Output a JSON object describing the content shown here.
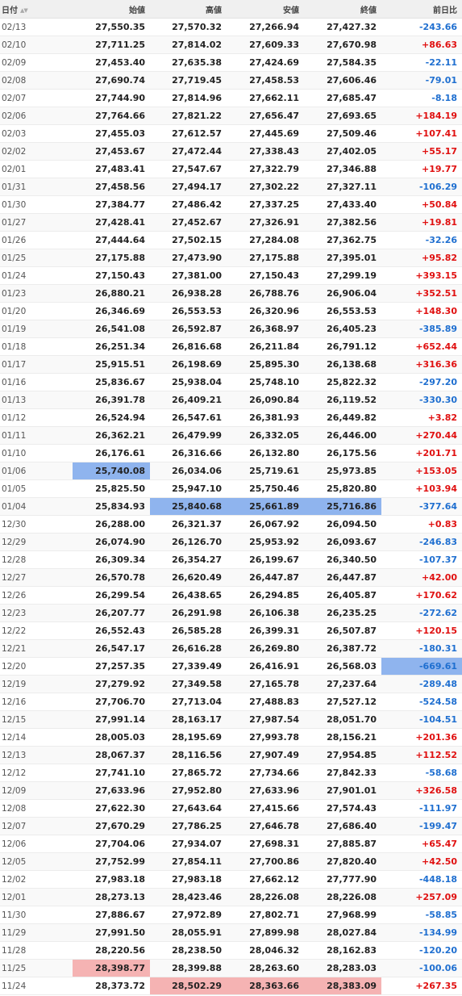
{
  "table": {
    "headers": {
      "date": "日付",
      "open": "始値",
      "high": "高値",
      "low": "安値",
      "close": "終値",
      "change": "前日比"
    },
    "sort_icons": "▲▼",
    "rows": [
      {
        "date": "02/13",
        "open": "27,550.35",
        "high": "27,570.32",
        "low": "27,266.94",
        "close": "27,427.32",
        "change": "-243.66"
      },
      {
        "date": "02/10",
        "open": "27,711.25",
        "high": "27,814.02",
        "low": "27,609.33",
        "close": "27,670.98",
        "change": "+86.63"
      },
      {
        "date": "02/09",
        "open": "27,453.40",
        "high": "27,635.38",
        "low": "27,424.69",
        "close": "27,584.35",
        "change": "-22.11"
      },
      {
        "date": "02/08",
        "open": "27,690.74",
        "high": "27,719.45",
        "low": "27,458.53",
        "close": "27,606.46",
        "change": "-79.01"
      },
      {
        "date": "02/07",
        "open": "27,744.90",
        "high": "27,814.96",
        "low": "27,662.11",
        "close": "27,685.47",
        "change": "-8.18"
      },
      {
        "date": "02/06",
        "open": "27,764.66",
        "high": "27,821.22",
        "low": "27,656.47",
        "close": "27,693.65",
        "change": "+184.19"
      },
      {
        "date": "02/03",
        "open": "27,455.03",
        "high": "27,612.57",
        "low": "27,445.69",
        "close": "27,509.46",
        "change": "+107.41"
      },
      {
        "date": "02/02",
        "open": "27,453.67",
        "high": "27,472.44",
        "low": "27,338.43",
        "close": "27,402.05",
        "change": "+55.17"
      },
      {
        "date": "02/01",
        "open": "27,483.41",
        "high": "27,547.67",
        "low": "27,322.79",
        "close": "27,346.88",
        "change": "+19.77"
      },
      {
        "date": "01/31",
        "open": "27,458.56",
        "high": "27,494.17",
        "low": "27,302.22",
        "close": "27,327.11",
        "change": "-106.29"
      },
      {
        "date": "01/30",
        "open": "27,384.77",
        "high": "27,486.42",
        "low": "27,337.25",
        "close": "27,433.40",
        "change": "+50.84"
      },
      {
        "date": "01/27",
        "open": "27,428.41",
        "high": "27,452.67",
        "low": "27,326.91",
        "close": "27,382.56",
        "change": "+19.81"
      },
      {
        "date": "01/26",
        "open": "27,444.64",
        "high": "27,502.15",
        "low": "27,284.08",
        "close": "27,362.75",
        "change": "-32.26"
      },
      {
        "date": "01/25",
        "open": "27,175.88",
        "high": "27,473.90",
        "low": "27,175.88",
        "close": "27,395.01",
        "change": "+95.82"
      },
      {
        "date": "01/24",
        "open": "27,150.43",
        "high": "27,381.00",
        "low": "27,150.43",
        "close": "27,299.19",
        "change": "+393.15"
      },
      {
        "date": "01/23",
        "open": "26,880.21",
        "high": "26,938.28",
        "low": "26,788.76",
        "close": "26,906.04",
        "change": "+352.51"
      },
      {
        "date": "01/20",
        "open": "26,346.69",
        "high": "26,553.53",
        "low": "26,320.96",
        "close": "26,553.53",
        "change": "+148.30"
      },
      {
        "date": "01/19",
        "open": "26,541.08",
        "high": "26,592.87",
        "low": "26,368.97",
        "close": "26,405.23",
        "change": "-385.89"
      },
      {
        "date": "01/18",
        "open": "26,251.34",
        "high": "26,816.68",
        "low": "26,211.84",
        "close": "26,791.12",
        "change": "+652.44"
      },
      {
        "date": "01/17",
        "open": "25,915.51",
        "high": "26,198.69",
        "low": "25,895.30",
        "close": "26,138.68",
        "change": "+316.36"
      },
      {
        "date": "01/16",
        "open": "25,836.67",
        "high": "25,938.04",
        "low": "25,748.10",
        "close": "25,822.32",
        "change": "-297.20"
      },
      {
        "date": "01/13",
        "open": "26,391.78",
        "high": "26,409.21",
        "low": "26,090.84",
        "close": "26,119.52",
        "change": "-330.30"
      },
      {
        "date": "01/12",
        "open": "26,524.94",
        "high": "26,547.61",
        "low": "26,381.93",
        "close": "26,449.82",
        "change": "+3.82"
      },
      {
        "date": "01/11",
        "open": "26,362.21",
        "high": "26,479.99",
        "low": "26,332.05",
        "close": "26,446.00",
        "change": "+270.44"
      },
      {
        "date": "01/10",
        "open": "26,176.61",
        "high": "26,316.66",
        "low": "26,132.80",
        "close": "26,175.56",
        "change": "+201.71"
      },
      {
        "date": "01/06",
        "open": "25,740.08",
        "high": "26,034.06",
        "low": "25,719.61",
        "close": "25,973.85",
        "change": "+153.05"
      },
      {
        "date": "01/05",
        "open": "25,825.50",
        "high": "25,947.10",
        "low": "25,750.46",
        "close": "25,820.80",
        "change": "+103.94"
      },
      {
        "date": "01/04",
        "open": "25,834.93",
        "high": "25,840.68",
        "low": "25,661.89",
        "close": "25,716.86",
        "change": "-377.64"
      },
      {
        "date": "12/30",
        "open": "26,288.00",
        "high": "26,321.37",
        "low": "26,067.92",
        "close": "26,094.50",
        "change": "+0.83"
      },
      {
        "date": "12/29",
        "open": "26,074.90",
        "high": "26,126.70",
        "low": "25,953.92",
        "close": "26,093.67",
        "change": "-246.83"
      },
      {
        "date": "12/28",
        "open": "26,309.34",
        "high": "26,354.27",
        "low": "26,199.67",
        "close": "26,340.50",
        "change": "-107.37"
      },
      {
        "date": "12/27",
        "open": "26,570.78",
        "high": "26,620.49",
        "low": "26,447.87",
        "close": "26,447.87",
        "change": "+42.00"
      },
      {
        "date": "12/26",
        "open": "26,299.54",
        "high": "26,438.65",
        "low": "26,294.85",
        "close": "26,405.87",
        "change": "+170.62"
      },
      {
        "date": "12/23",
        "open": "26,207.77",
        "high": "26,291.98",
        "low": "26,106.38",
        "close": "26,235.25",
        "change": "-272.62"
      },
      {
        "date": "12/22",
        "open": "26,552.43",
        "high": "26,585.28",
        "low": "26,399.31",
        "close": "26,507.87",
        "change": "+120.15"
      },
      {
        "date": "12/21",
        "open": "26,547.17",
        "high": "26,616.28",
        "low": "26,269.80",
        "close": "26,387.72",
        "change": "-180.31"
      },
      {
        "date": "12/20",
        "open": "27,257.35",
        "high": "27,339.49",
        "low": "26,416.91",
        "close": "26,568.03",
        "change": "-669.61"
      },
      {
        "date": "12/19",
        "open": "27,279.92",
        "high": "27,349.58",
        "low": "27,165.78",
        "close": "27,237.64",
        "change": "-289.48"
      },
      {
        "date": "12/16",
        "open": "27,706.70",
        "high": "27,713.04",
        "low": "27,488.83",
        "close": "27,527.12",
        "change": "-524.58"
      },
      {
        "date": "12/15",
        "open": "27,991.14",
        "high": "28,163.17",
        "low": "27,987.54",
        "close": "28,051.70",
        "change": "-104.51"
      },
      {
        "date": "12/14",
        "open": "28,005.03",
        "high": "28,195.69",
        "low": "27,993.78",
        "close": "28,156.21",
        "change": "+201.36"
      },
      {
        "date": "12/13",
        "open": "28,067.37",
        "high": "28,116.56",
        "low": "27,907.49",
        "close": "27,954.85",
        "change": "+112.52"
      },
      {
        "date": "12/12",
        "open": "27,741.10",
        "high": "27,865.72",
        "low": "27,734.66",
        "close": "27,842.33",
        "change": "-58.68"
      },
      {
        "date": "12/09",
        "open": "27,633.96",
        "high": "27,952.80",
        "low": "27,633.96",
        "close": "27,901.01",
        "change": "+326.58"
      },
      {
        "date": "12/08",
        "open": "27,622.30",
        "high": "27,643.64",
        "low": "27,415.66",
        "close": "27,574.43",
        "change": "-111.97"
      },
      {
        "date": "12/07",
        "open": "27,670.29",
        "high": "27,786.25",
        "low": "27,646.78",
        "close": "27,686.40",
        "change": "-199.47"
      },
      {
        "date": "12/06",
        "open": "27,704.06",
        "high": "27,934.07",
        "low": "27,698.31",
        "close": "27,885.87",
        "change": "+65.47"
      },
      {
        "date": "12/05",
        "open": "27,752.99",
        "high": "27,854.11",
        "low": "27,700.86",
        "close": "27,820.40",
        "change": "+42.50"
      },
      {
        "date": "12/02",
        "open": "27,983.18",
        "high": "27,983.18",
        "low": "27,662.12",
        "close": "27,777.90",
        "change": "-448.18"
      },
      {
        "date": "12/01",
        "open": "28,273.13",
        "high": "28,423.46",
        "low": "28,226.08",
        "close": "28,226.08",
        "change": "+257.09"
      },
      {
        "date": "11/30",
        "open": "27,886.67",
        "high": "27,972.89",
        "low": "27,802.71",
        "close": "27,968.99",
        "change": "-58.85"
      },
      {
        "date": "11/29",
        "open": "27,991.50",
        "high": "28,055.91",
        "low": "27,899.98",
        "close": "28,027.84",
        "change": "-134.99"
      },
      {
        "date": "11/28",
        "open": "28,220.56",
        "high": "28,238.50",
        "low": "28,046.32",
        "close": "28,162.83",
        "change": "-120.20"
      },
      {
        "date": "11/25",
        "open": "28,398.77",
        "high": "28,399.88",
        "low": "28,263.60",
        "close": "28,283.03",
        "change": "-100.06"
      },
      {
        "date": "11/24",
        "open": "28,373.72",
        "high": "28,502.29",
        "low": "28,363.66",
        "close": "28,383.09",
        "change": "+267.35"
      }
    ],
    "highlights": {
      "blue": [
        [
          "01/06",
          "open"
        ],
        [
          "01/04",
          "high"
        ],
        [
          "01/04",
          "low"
        ],
        [
          "01/04",
          "close"
        ],
        [
          "12/20",
          "change"
        ]
      ],
      "red": [
        [
          "11/25",
          "open"
        ],
        [
          "11/24",
          "high"
        ],
        [
          "11/24",
          "low"
        ],
        [
          "11/24",
          "close"
        ]
      ]
    },
    "colors": {
      "up": "#e01010",
      "down": "#1f6fd0",
      "highlight_blue": "#8fb4ee",
      "highlight_red": "#f5b3b3"
    }
  }
}
